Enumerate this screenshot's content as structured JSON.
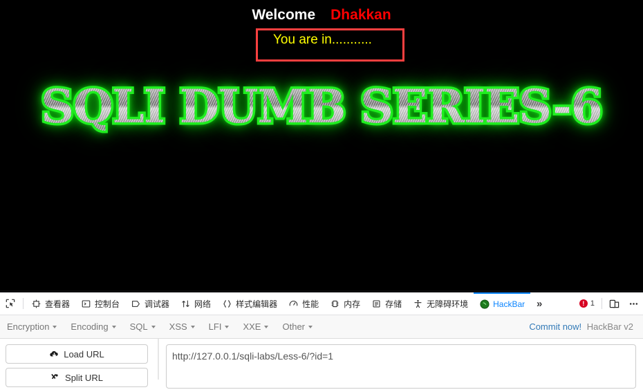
{
  "page": {
    "welcome_label": "Welcome",
    "username": "Dhakkan",
    "message": "You are in...........",
    "banner": "SQLI DUMB SERIES-6",
    "colors": {
      "background": "#000000",
      "welcome": "#ffffff",
      "username": "#ff0000",
      "message": "#ffff00",
      "box_border": "#ff4040",
      "banner_glow": "#20ee20"
    }
  },
  "devtools": {
    "picker_icon": "element-picker-icon",
    "tabs": [
      {
        "label": "查看器",
        "icon": "inspector-icon",
        "active": false
      },
      {
        "label": "控制台",
        "icon": "console-icon",
        "active": false
      },
      {
        "label": "调试器",
        "icon": "debugger-icon",
        "active": false
      },
      {
        "label": "网络",
        "icon": "network-icon",
        "active": false
      },
      {
        "label": "样式编辑器",
        "icon": "style-editor-icon",
        "active": false
      },
      {
        "label": "性能",
        "icon": "performance-icon",
        "active": false
      },
      {
        "label": "内存",
        "icon": "memory-icon",
        "active": false
      },
      {
        "label": "存储",
        "icon": "storage-icon",
        "active": false
      },
      {
        "label": "无障碍环境",
        "icon": "accessibility-icon",
        "active": false
      },
      {
        "label": "HackBar",
        "icon": "hackbar-icon",
        "active": true
      }
    ],
    "overflow_label": "»",
    "error_count": "1",
    "error_icon": "error-badge-icon",
    "responsive_icon": "responsive-design-mode-icon",
    "meatball_icon": "more-options-icon",
    "active_tab_color": "#0a84ff"
  },
  "hackbar": {
    "menus": [
      {
        "label": "Encryption"
      },
      {
        "label": "Encoding"
      },
      {
        "label": "SQL"
      },
      {
        "label": "XSS"
      },
      {
        "label": "LFI"
      },
      {
        "label": "XXE"
      },
      {
        "label": "Other"
      }
    ],
    "commit_label": "Commit now!",
    "version_label": "HackBar v2",
    "buttons": [
      {
        "label": "Load URL",
        "icon": "cloud-download-icon"
      },
      {
        "label": "Split URL",
        "icon": "split-icon"
      }
    ],
    "url_value": "http://127.0.0.1/sqli-labs/Less-6/?id=1",
    "url_placeholder": "http://"
  }
}
